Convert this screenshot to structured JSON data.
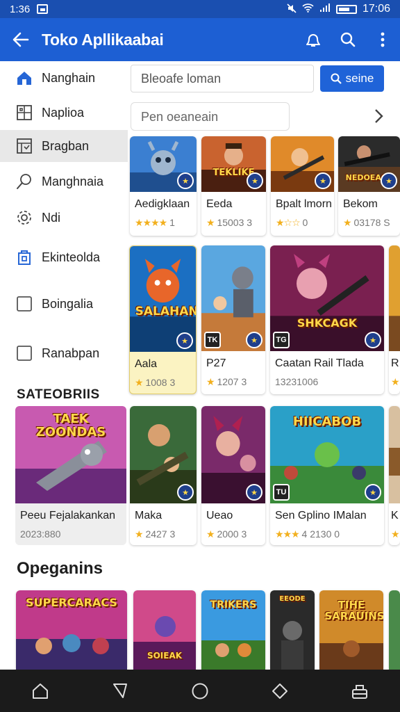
{
  "status_bar": {
    "time_left": "1:36",
    "time_right": "17:06"
  },
  "app_bar": {
    "title": "Toko Apllikaabai"
  },
  "sidebar": {
    "items": [
      {
        "label": "Nanghain",
        "icon": "home-icon"
      },
      {
        "label": "Naplioa",
        "icon": "grid-icon"
      },
      {
        "label": "Bragban",
        "icon": "gallery-icon"
      },
      {
        "label": "Manghnaia",
        "icon": "search-icon"
      },
      {
        "label": "Ndi",
        "icon": "gear-icon"
      },
      {
        "label": "Ekinteolda",
        "icon": "shield-icon"
      },
      {
        "label": "Boingalia",
        "icon": "checkbox-icon"
      },
      {
        "label": "Ranabpan",
        "icon": "checkbox-icon"
      }
    ],
    "section_title": "SATEOBRIIS"
  },
  "search": {
    "placeholder": "Bleoafe loman",
    "button_label": "seine"
  },
  "filter": {
    "placeholder": "Pen oeaneain"
  },
  "rows": [
    {
      "cards": [
        {
          "name": "Aedigklaan",
          "rating_stars": "★★★★",
          "rating_tail": "1",
          "banner": ""
        },
        {
          "name": "Eeda",
          "rating_stars": "★",
          "rating_tail": "15003 3",
          "banner": "TEKLIKE"
        },
        {
          "name": "Bpalt lmorn",
          "rating_stars": "★☆☆",
          "rating_tail": "0",
          "banner": ""
        },
        {
          "name": "Bekom",
          "rating_stars": "★",
          "rating_tail": "03178 S",
          "banner": "NEDOEAGE"
        }
      ]
    },
    {
      "cards": [
        {
          "name": "Aala",
          "rating_stars": "★",
          "rating_tail": "1008 3",
          "banner": "SALAHAN"
        },
        {
          "name": "P27",
          "rating_stars": "★",
          "rating_tail": "1207 3",
          "banner": ""
        },
        {
          "name": "Caatan Rail Tlada",
          "rating_stars": "",
          "rating_tail": "13231006",
          "banner": "SHKCAGK"
        },
        {
          "name": "R",
          "rating_stars": "★",
          "rating_tail": "",
          "banner": ""
        }
      ]
    },
    {
      "cards": [
        {
          "name": "Peeu Fejalakankan",
          "rating_stars": "",
          "rating_tail": "2023:880",
          "banner": "TAEK ZOONDAS"
        },
        {
          "name": "Maka",
          "rating_stars": "★",
          "rating_tail": "2427 3",
          "banner": ""
        },
        {
          "name": "Ueao",
          "rating_stars": "★",
          "rating_tail": "2000 3",
          "banner": ""
        },
        {
          "name": "Sen Gplino IMalan",
          "rating_stars": "★★★",
          "rating_tail": "4 2130 0",
          "banner": "HIICABOB"
        },
        {
          "name": "K",
          "rating_stars": "★",
          "rating_tail": "",
          "banner": ""
        }
      ]
    }
  ],
  "section2_title": "Opeganins",
  "bottom_row_banners": [
    "SUPERCARACS",
    "SOIEAK",
    "TRIKERS",
    "EEODE",
    "TIHE SARAUINS"
  ],
  "nav_icons": [
    "home-icon",
    "back-icon",
    "circle-icon",
    "diamond-icon",
    "tray-icon"
  ],
  "colors": {
    "primary": "#1d5fd3",
    "status_bar": "#1a4fb0",
    "star": "#f2b01e",
    "nav_bar": "#1b1b1b"
  }
}
